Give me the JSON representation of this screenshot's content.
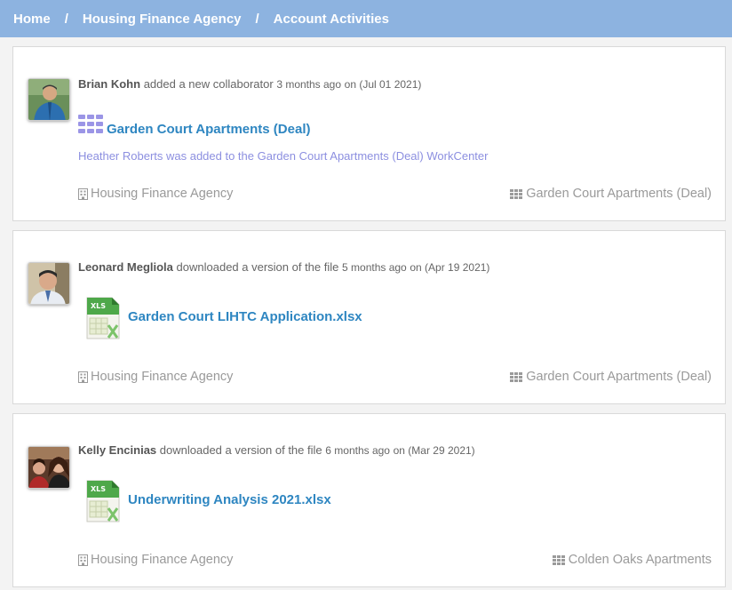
{
  "breadcrumb": {
    "items": [
      "Home",
      "Housing Finance Agency",
      "Account Activities"
    ],
    "separator": "/"
  },
  "activities": [
    {
      "actor": "Brian Kohn",
      "action": "added a new collaborator",
      "time_ago": "3 months ago",
      "date": "on (Jul 01 2021)",
      "object_icon": "deal-grid-icon",
      "object_title": "Garden Court Apartments (Deal)",
      "object_desc": "Heather Roberts was added to the Garden Court Apartments (Deal) WorkCenter",
      "footer_left": "Housing Finance Agency",
      "footer_right": "Garden Court Apartments (Deal)"
    },
    {
      "actor": "Leonard Megliola",
      "action": "downloaded a version of the file",
      "time_ago": "5 months ago",
      "date": "on (Apr 19 2021)",
      "object_icon": "xls-file-icon",
      "object_title": "Garden Court LIHTC Application.xlsx",
      "footer_left": "Housing Finance Agency",
      "footer_right": "Garden Court Apartments (Deal)"
    },
    {
      "actor": "Kelly Encinias",
      "action": "downloaded a version of the file",
      "time_ago": "6 months ago",
      "date": "on (Mar 29 2021)",
      "object_icon": "xls-file-icon",
      "object_title": "Underwriting Analysis 2021.xlsx",
      "footer_left": "Housing Finance Agency",
      "footer_right": "Colden Oaks Apartments"
    }
  ],
  "colors": {
    "breadcrumb_bg": "#8db3e0",
    "link": "#2e86c1",
    "desc": "#8c8fe0",
    "muted": "#9a9a9a",
    "deal_icon": "#9b95e6",
    "xls_green": "#4ea84a"
  },
  "icons": {
    "xls_label": "XLS"
  }
}
